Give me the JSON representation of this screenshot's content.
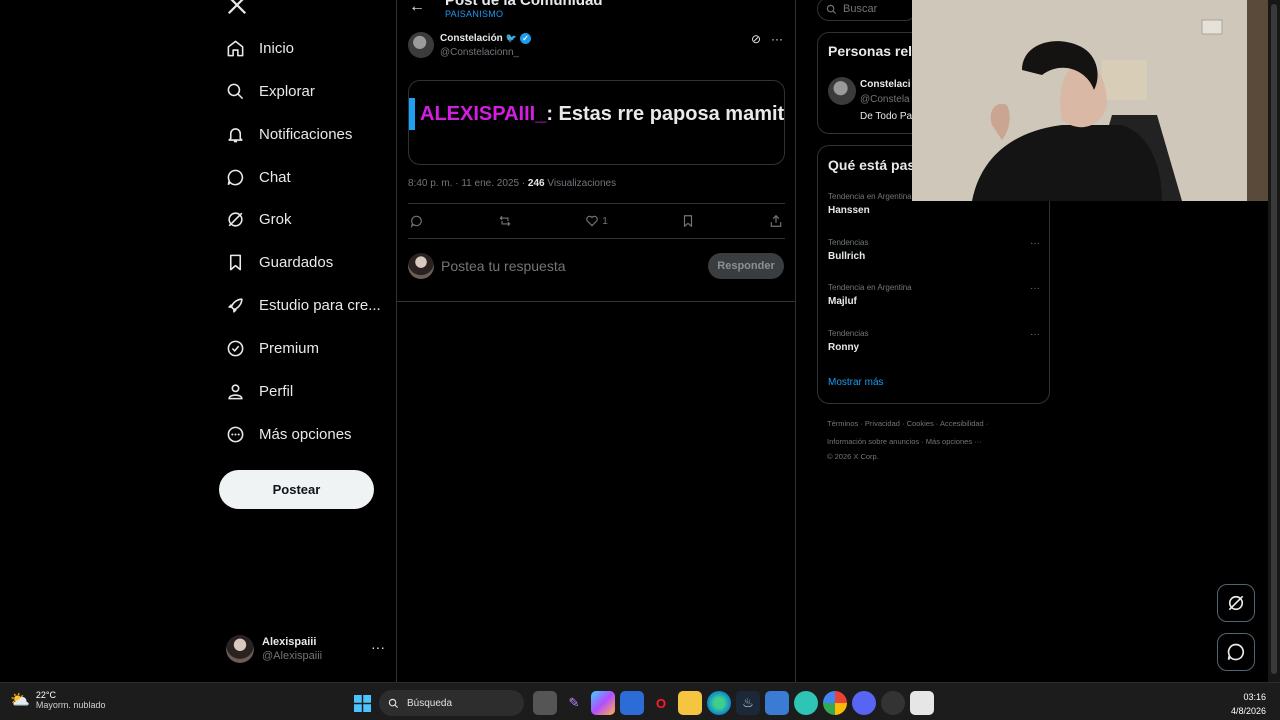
{
  "nav": {
    "items": [
      {
        "label": "Inicio",
        "icon": "home-icon"
      },
      {
        "label": "Explorar",
        "icon": "search-icon"
      },
      {
        "label": "Notificaciones",
        "icon": "bell-icon"
      },
      {
        "label": "Chat",
        "icon": "chat-icon"
      },
      {
        "label": "Grok",
        "icon": "grok-icon"
      },
      {
        "label": "Guardados",
        "icon": "bookmark-icon"
      },
      {
        "label": "Estudio para cre...",
        "icon": "rocket-icon"
      },
      {
        "label": "Premium",
        "icon": "verified-icon"
      },
      {
        "label": "Perfil",
        "icon": "person-icon"
      },
      {
        "label": "Más opciones",
        "icon": "more-circle-icon"
      }
    ],
    "post_button": "Postear"
  },
  "account": {
    "name": "Alexispaiii",
    "handle": "@Alexispaiii",
    "more": "···"
  },
  "header": {
    "title": "Post de la Comunidad",
    "subtitle": "PAISANISMO"
  },
  "post": {
    "author_name": "Constelación",
    "author_handle": "@Constelacionn_",
    "chat_user": "ALEXISPAIII_",
    "chat_message": ": Estas rre paposa mamita",
    "time": "8:40 p. m. · 11 ene. 2025 ·",
    "views_count": "246",
    "views_label": "Visualizaciones",
    "like_count": "1"
  },
  "reply": {
    "placeholder": "Postea tu respuesta",
    "button": "Responder"
  },
  "search": {
    "placeholder": "Buscar"
  },
  "related": {
    "title": "Personas rele",
    "person_name": "Constelaci",
    "person_handle": "@Constela",
    "person_bio": "De Todo Pa"
  },
  "trends": {
    "title": "Qué está pas",
    "items": [
      {
        "context": "Tendencia en Argentina",
        "name": "Hanssen"
      },
      {
        "context": "Tendencias",
        "name": "Bullrich"
      },
      {
        "context": "Tendencia en Argentina",
        "name": "Majluf"
      },
      {
        "context": "Tendencias",
        "name": "Ronny"
      }
    ],
    "show_more": "Mostrar más"
  },
  "footer": {
    "line1": "Términos  ·  Privacidad  ·  Cookies  ·  Accesibilidad  ·",
    "line2": "Información sobre anuncios  ·  Más opciones ···",
    "line3": "© 2026 X Corp."
  },
  "taskbar": {
    "temp": "22°C",
    "weather": "Mayorm. nublado",
    "search": "Búsqueda",
    "time": "03:16",
    "date": "4/8/2026"
  },
  "colors": {
    "accent": "#1d9bf0",
    "chat_user": "#d21ee0",
    "background": "#000000"
  }
}
